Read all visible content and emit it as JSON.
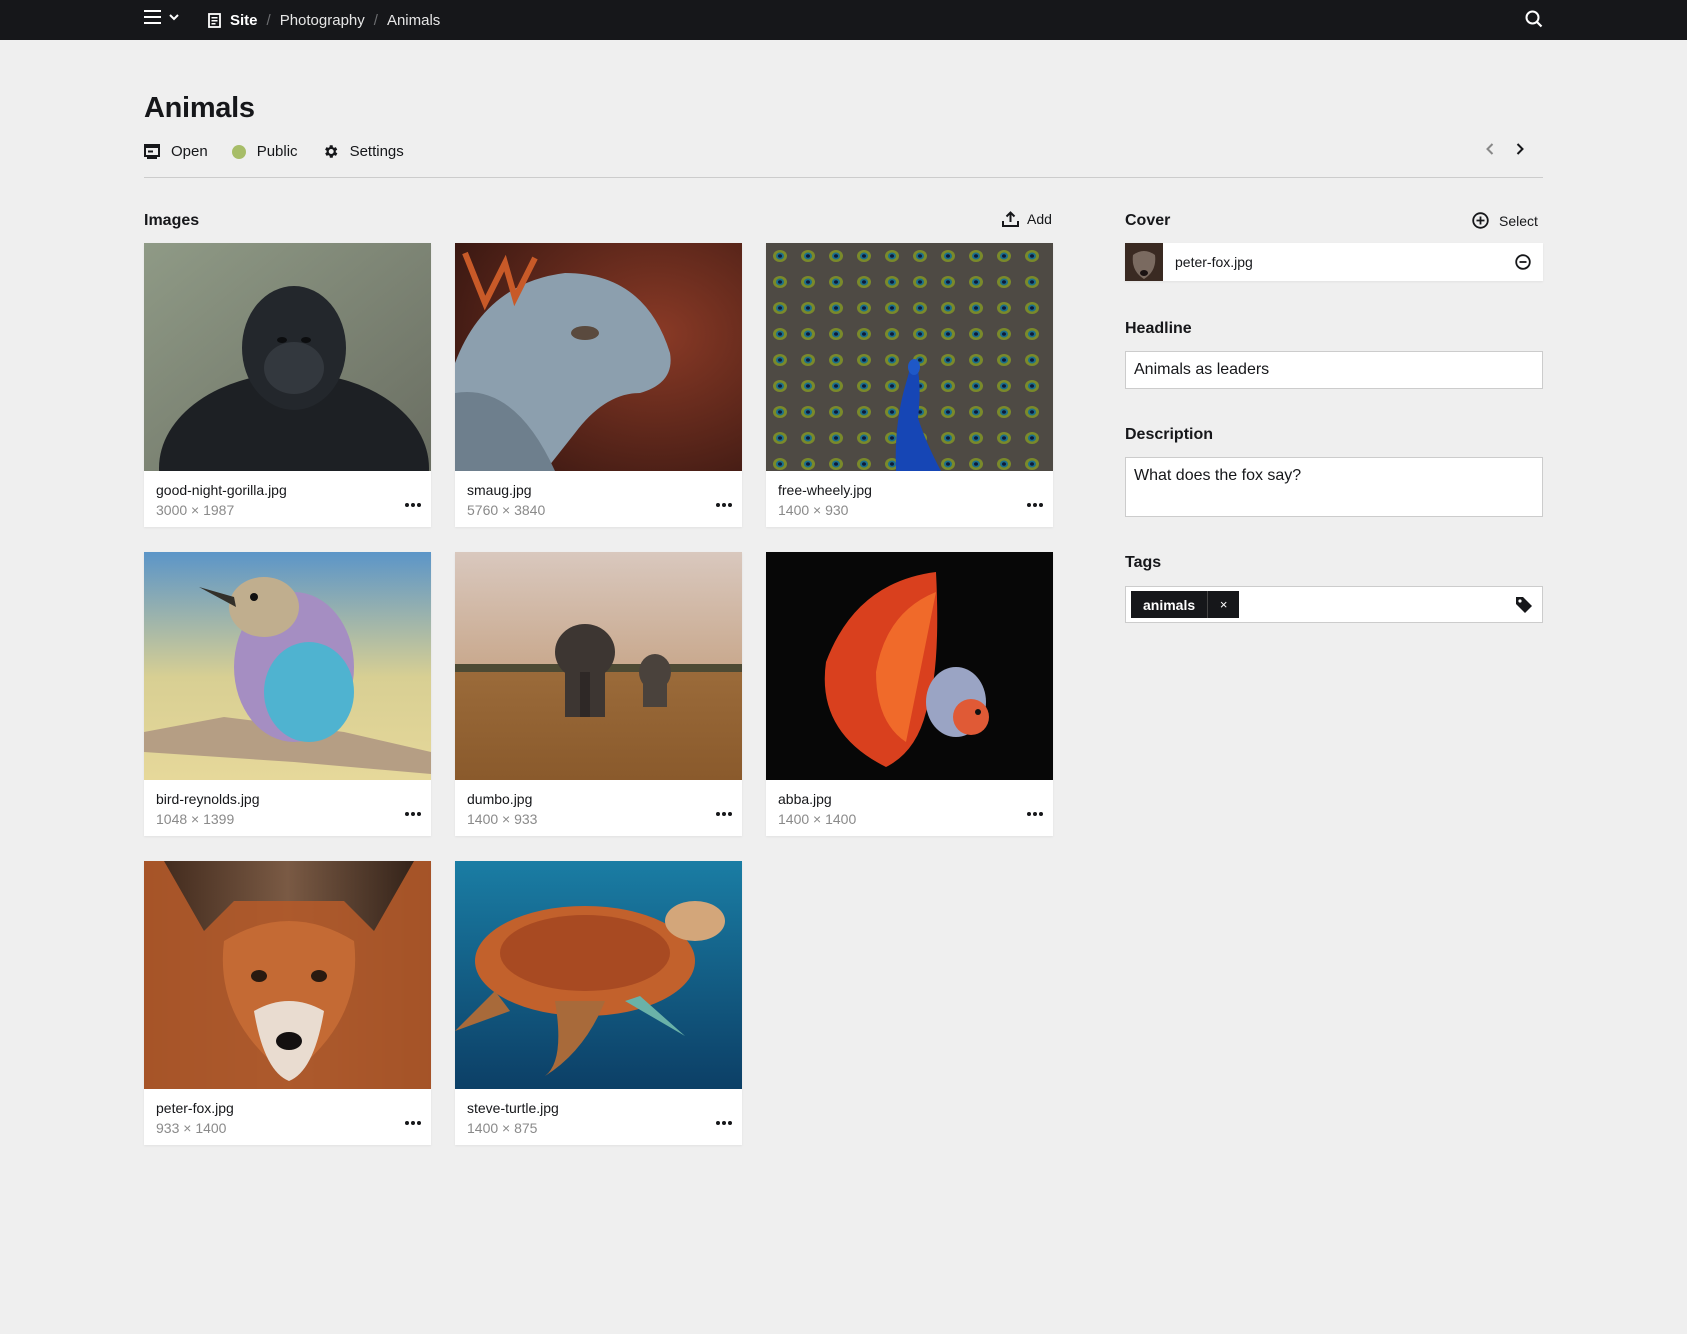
{
  "topbar": {
    "breadcrumbs": [
      {
        "label": "Site"
      },
      {
        "label": "Photography"
      },
      {
        "label": "Animals"
      }
    ],
    "icons": [
      "hamburger-icon",
      "chevron-down-icon",
      "page-icon",
      "search-icon"
    ]
  },
  "header": {
    "title": "Animals",
    "open_label": "Open",
    "status_label": "Public",
    "status_color": "#a7bd68",
    "settings_label": "Settings"
  },
  "images": {
    "label": "Images",
    "add_label": "Add",
    "items": [
      {
        "filename": "good-night-gorilla.jpg",
        "dimensions": "3000 × 1987"
      },
      {
        "filename": "smaug.jpg",
        "dimensions": "5760 × 3840"
      },
      {
        "filename": "free-wheely.jpg",
        "dimensions": "1400 × 930"
      },
      {
        "filename": "bird-reynolds.jpg",
        "dimensions": "1048 × 1399"
      },
      {
        "filename": "dumbo.jpg",
        "dimensions": "1400 × 933"
      },
      {
        "filename": "abba.jpg",
        "dimensions": "1400 × 1400"
      },
      {
        "filename": "peter-fox.jpg",
        "dimensions": "933 × 1400"
      },
      {
        "filename": "steve-turtle.jpg",
        "dimensions": "1400 × 875"
      }
    ]
  },
  "cover": {
    "label": "Cover",
    "select_label": "Select",
    "filename": "peter-fox.jpg"
  },
  "headline": {
    "label": "Headline",
    "value": "Animals as leaders"
  },
  "description": {
    "label": "Description",
    "value": "What does the fox say?"
  },
  "tags": {
    "label": "Tags",
    "items": [
      {
        "label": "animals",
        "remove": "×"
      }
    ]
  },
  "colors": {
    "topbar": "#16171a",
    "background": "#efefef",
    "status_public": "#a7bd68"
  }
}
